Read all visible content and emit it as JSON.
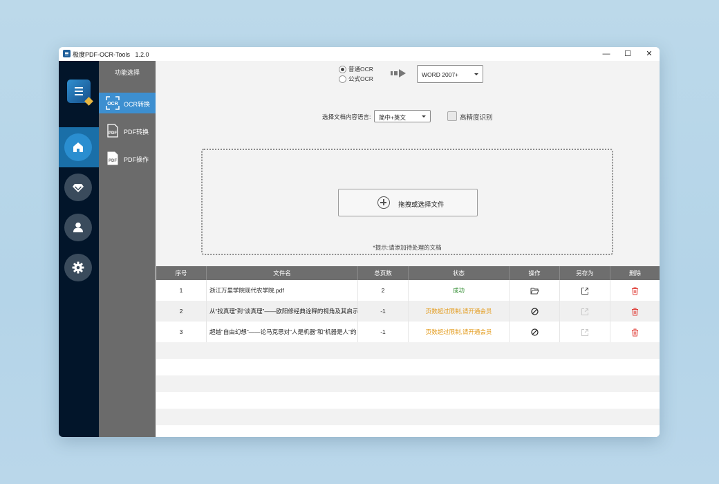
{
  "window": {
    "title": "极度PDF-OCR-Tools",
    "version": "1.2.0",
    "minimize": "—",
    "maximize": "☐",
    "close": "✕"
  },
  "sidebar": {
    "nav": [
      {
        "name": "home",
        "icon": "home-icon"
      },
      {
        "name": "vip",
        "icon": "diamond-icon"
      },
      {
        "name": "account",
        "icon": "user-icon"
      },
      {
        "name": "settings",
        "icon": "gear-icon"
      }
    ]
  },
  "subnav": {
    "header": "功能选择",
    "items": [
      {
        "label": "OCR转换",
        "icon": "ocr-icon"
      },
      {
        "label": "PDF转换",
        "icon": "pdf-file-icon"
      },
      {
        "label": "PDF操作",
        "icon": "pdf-doc-icon"
      }
    ]
  },
  "ocr_mode": {
    "options": [
      "普通OCR",
      "公式OCR"
    ],
    "selected": "普通OCR"
  },
  "output_format": {
    "selected": "WORD 2007+"
  },
  "language": {
    "label": "选择文档内容语言:",
    "selected": "简中+英文"
  },
  "high_precision": {
    "label": "高精度识别",
    "checked": false
  },
  "dropzone": {
    "button_label": "拖拽或选择文件",
    "hint": "*提示:请添加待处理的文档"
  },
  "table": {
    "headers": [
      "序号",
      "文件名",
      "总页数",
      "状态",
      "操作",
      "另存为",
      "删除"
    ],
    "rows": [
      {
        "index": "1",
        "filename": "浙江万里学院现代农学院.pdf",
        "pages": "2",
        "status": "成功",
        "status_type": "success",
        "action_icon": "folder-open-icon",
        "save_enabled": true
      },
      {
        "index": "2",
        "filename": "从“找真理”到“谈真理”——欧阳修经典诠释的视角及其启示.",
        "pages": "-1",
        "status": "页数超过限制,请开通会员",
        "status_type": "warning",
        "action_icon": "block-icon",
        "save_enabled": false
      },
      {
        "index": "3",
        "filename": "超越“自由幻想”——论马克思对“人是机器”和“机器是人”的",
        "pages": "-1",
        "status": "页数超过限制,请开通会员",
        "status_type": "warning",
        "action_icon": "block-icon",
        "save_enabled": false
      }
    ]
  },
  "colors": {
    "sidebar_bg": "#02152a",
    "accent": "#2a8ed0",
    "success": "#2d8a2d",
    "warning": "#e39b1c",
    "delete": "#e0403a"
  }
}
